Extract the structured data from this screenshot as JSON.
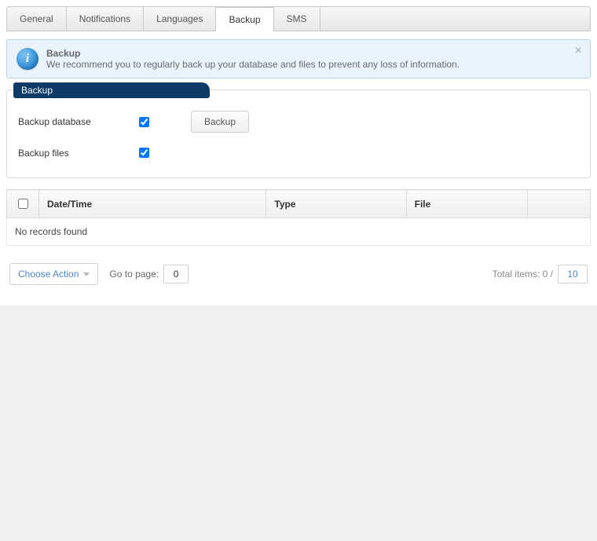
{
  "tabs": [
    {
      "label": "General"
    },
    {
      "label": "Notifications"
    },
    {
      "label": "Languages"
    },
    {
      "label": "Backup"
    },
    {
      "label": "SMS"
    }
  ],
  "active_tab_index": 3,
  "notice": {
    "title": "Backup",
    "body": "We recommend you to regularly back up your database and files to prevent any loss of information."
  },
  "panel": {
    "title": "Backup",
    "backup_db_label": "Backup database",
    "backup_files_label": "Backup files",
    "backup_db_checked": true,
    "backup_files_checked": true,
    "button_label": "Backup"
  },
  "table": {
    "columns": [
      "Date/Time",
      "Type",
      "File"
    ],
    "empty_text": "No records found"
  },
  "footer": {
    "choose_label": "Choose Action",
    "goto_label": "Go to page:",
    "goto_value": "0",
    "total_label": "Total items: 0 /",
    "per_page": "10"
  }
}
